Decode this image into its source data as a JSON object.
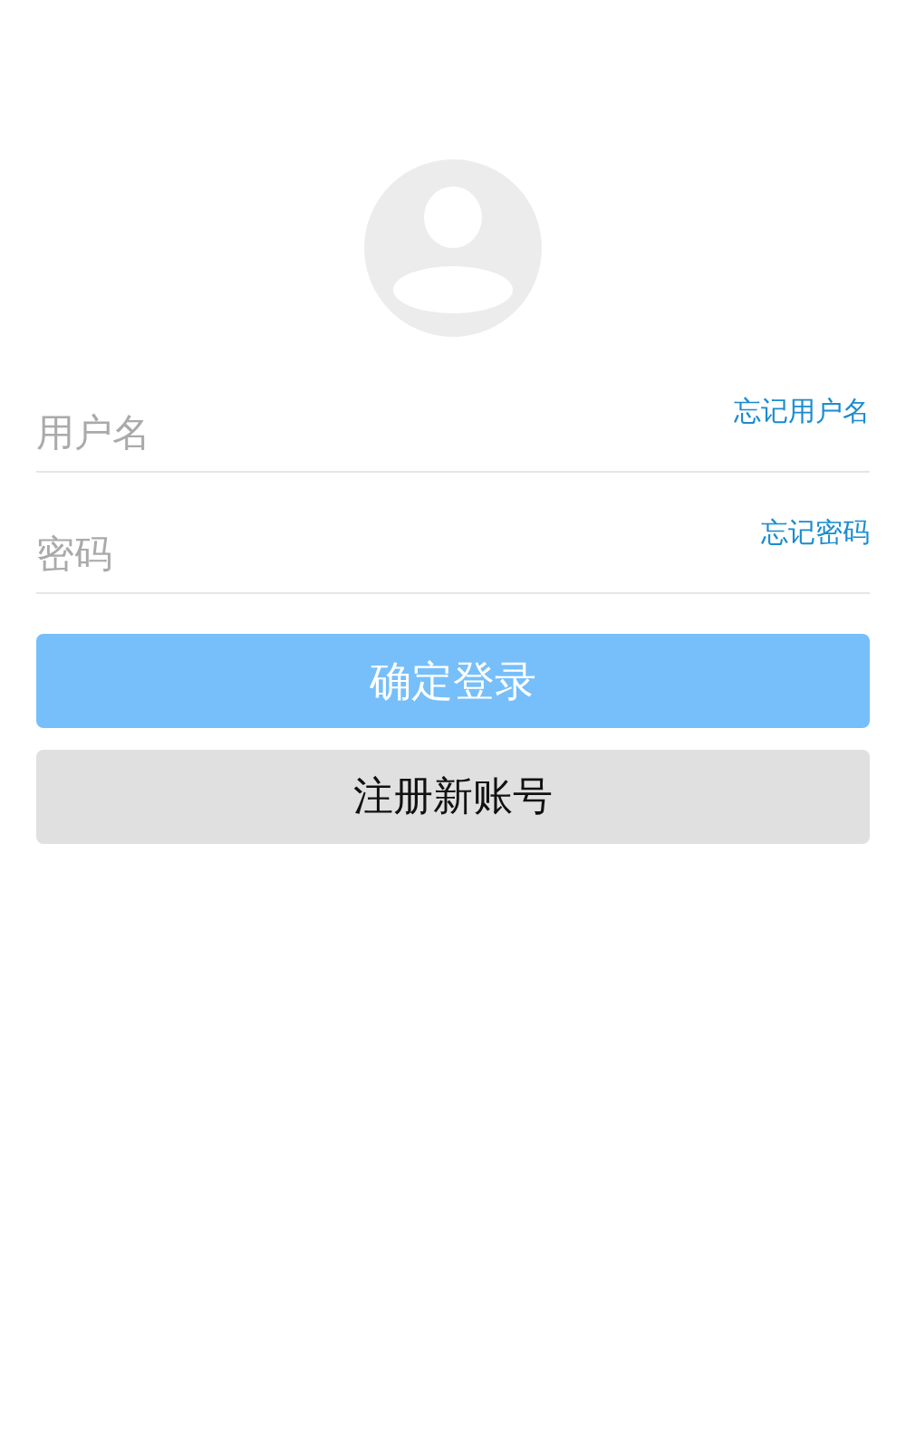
{
  "fields": [
    {
      "placeholder": "用户名",
      "link": "忘记用户名"
    },
    {
      "placeholder": "密码",
      "link": "忘记密码"
    }
  ],
  "buttons": [
    {
      "kind": "primary",
      "label": "确定登录"
    },
    {
      "kind": "secondary",
      "label": "注册新账号"
    }
  ]
}
